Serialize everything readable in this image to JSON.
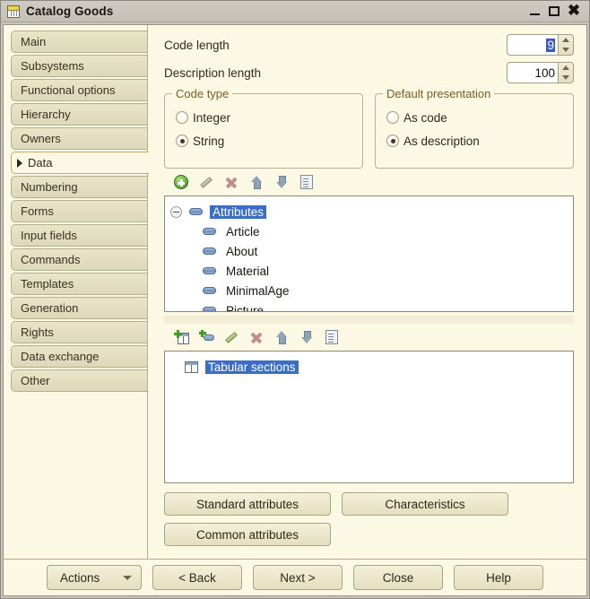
{
  "window": {
    "title": "Catalog Goods",
    "icon": "table-icon",
    "controls": {
      "minimize": "minimize-icon",
      "maximize": "maximize-icon",
      "close": "close-icon"
    }
  },
  "sidebar": {
    "items": [
      {
        "label": "Main",
        "selected": false
      },
      {
        "label": "Subsystems",
        "selected": false
      },
      {
        "label": "Functional options",
        "selected": false
      },
      {
        "label": "Hierarchy",
        "selected": false
      },
      {
        "label": "Owners",
        "selected": false
      },
      {
        "label": "Data",
        "selected": true
      },
      {
        "label": "Numbering",
        "selected": false
      },
      {
        "label": "Forms",
        "selected": false
      },
      {
        "label": "Input fields",
        "selected": false
      },
      {
        "label": "Commands",
        "selected": false
      },
      {
        "label": "Templates",
        "selected": false
      },
      {
        "label": "Generation",
        "selected": false
      },
      {
        "label": "Rights",
        "selected": false
      },
      {
        "label": "Data exchange",
        "selected": false
      },
      {
        "label": "Other",
        "selected": false
      }
    ]
  },
  "main": {
    "fields": [
      {
        "label": "Code length",
        "value": "9",
        "selected_text": true
      },
      {
        "label": "Description length",
        "value": "100",
        "selected_text": false
      }
    ],
    "code_type": {
      "title": "Code type",
      "options": [
        {
          "label": "Integer",
          "checked": false
        },
        {
          "label": "String",
          "checked": true
        }
      ]
    },
    "default_presentation": {
      "title": "Default presentation",
      "options": [
        {
          "label": "As code",
          "checked": false
        },
        {
          "label": "As description",
          "checked": true
        }
      ]
    },
    "attributes_toolbar": [
      "add-icon",
      "edit-icon",
      "delete-icon",
      "move-up-icon",
      "move-down-icon",
      "list-icon"
    ],
    "attributes_tree": {
      "root": {
        "label": "Attributes",
        "selected": true,
        "expanded": true
      },
      "children": [
        {
          "label": "Article"
        },
        {
          "label": "About"
        },
        {
          "label": "Material"
        },
        {
          "label": "MinimalAge"
        },
        {
          "label": "Picture"
        }
      ]
    },
    "tabular_toolbar": [
      "add-table-icon",
      "add-attribute-icon",
      "edit-icon",
      "delete-icon",
      "move-up-icon",
      "move-down-icon",
      "list-icon"
    ],
    "tabular_tree": {
      "root": {
        "label": "Tabular sections",
        "selected": true
      }
    },
    "buttons": [
      {
        "label": "Standard attributes"
      },
      {
        "label": "Characteristics"
      },
      {
        "label": "Common attributes"
      }
    ]
  },
  "footer": {
    "actions": {
      "label": "Actions",
      "icon": "chevron-down-icon"
    },
    "back": "< Back",
    "next": "Next >",
    "close": "Close",
    "help": "Help"
  },
  "colors": {
    "window_bg": "#c8c4bc",
    "panel_bg": "#fbf8e4",
    "tab_bg": "#e3dfc1",
    "selection_blue": "#3a6ec4",
    "spin_selection": "#3a57c4",
    "group_title": "#7a5d23",
    "border": "#b4ae8e"
  }
}
